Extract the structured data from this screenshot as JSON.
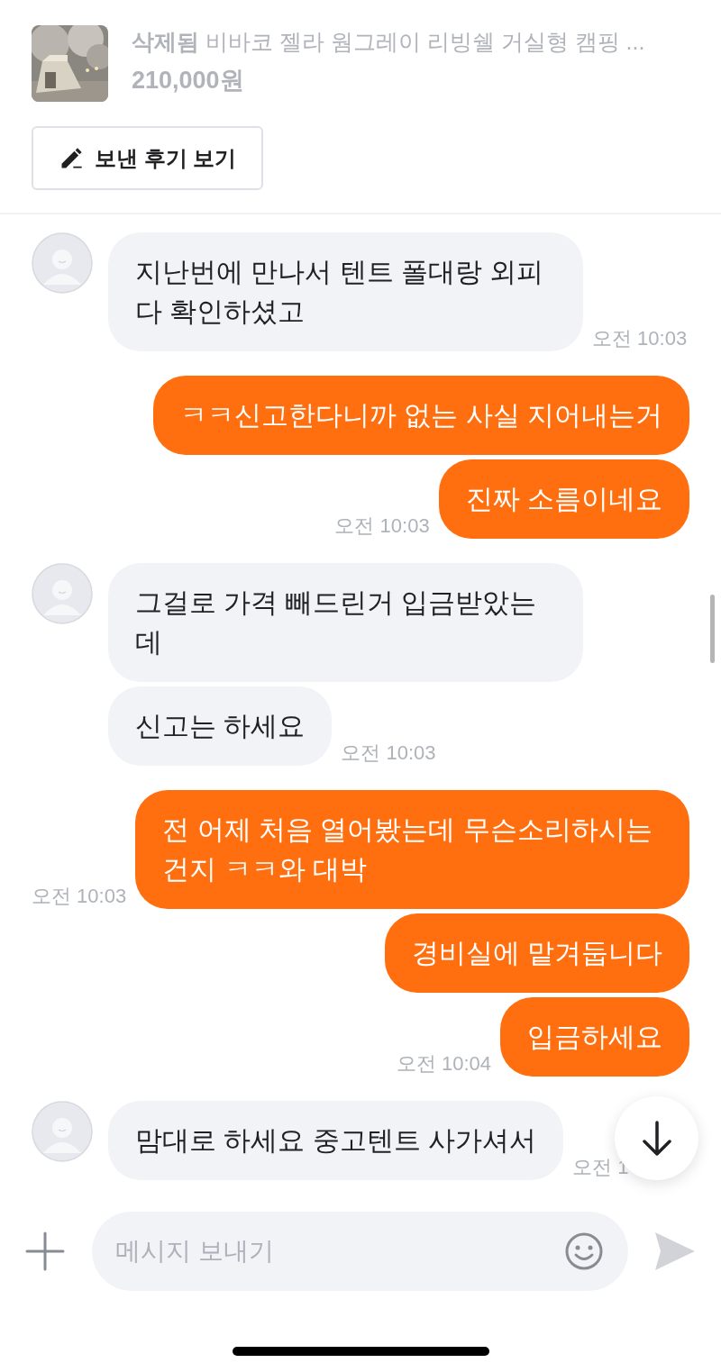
{
  "product": {
    "title": "**삭제됨** 비바코 젤라 웜그레이 리빙쉘 거실형 캠핑 ...",
    "price": "210,000원"
  },
  "review_button": "보낸 후기 보기",
  "groups": [
    {
      "kind": "received",
      "messages": [
        {
          "text": "지난번에 만나서 텐트 폴대랑 외피 다 확인하셨고",
          "time": "오전 10:03"
        }
      ]
    },
    {
      "kind": "sent",
      "messages": [
        {
          "text": "ㅋㅋ신고한다니까 없는 사실 지어내는거"
        },
        {
          "text": "진짜 소름이네요",
          "time": "오전 10:03"
        }
      ]
    },
    {
      "kind": "received",
      "messages": [
        {
          "text": "그걸로 가격 빼드린거 입금받았는데"
        },
        {
          "text": "신고는 하세요",
          "time": "오전 10:03"
        }
      ]
    },
    {
      "kind": "sent",
      "messages": [
        {
          "text": "전 어제 처음 열어봤는데 무슨소리하시는 건지 ㅋㅋ와 대박",
          "time": "오전 10:03"
        },
        {
          "text": "경비실에 맡겨둡니다"
        },
        {
          "text": "입금하세요",
          "time": "오전 10:04"
        }
      ]
    },
    {
      "kind": "received",
      "messages": [
        {
          "text": "맘대로 하세요 중고텐트 사가셔서",
          "time": "오전 1"
        }
      ]
    }
  ],
  "composer": {
    "placeholder": "메시지 보내기"
  }
}
